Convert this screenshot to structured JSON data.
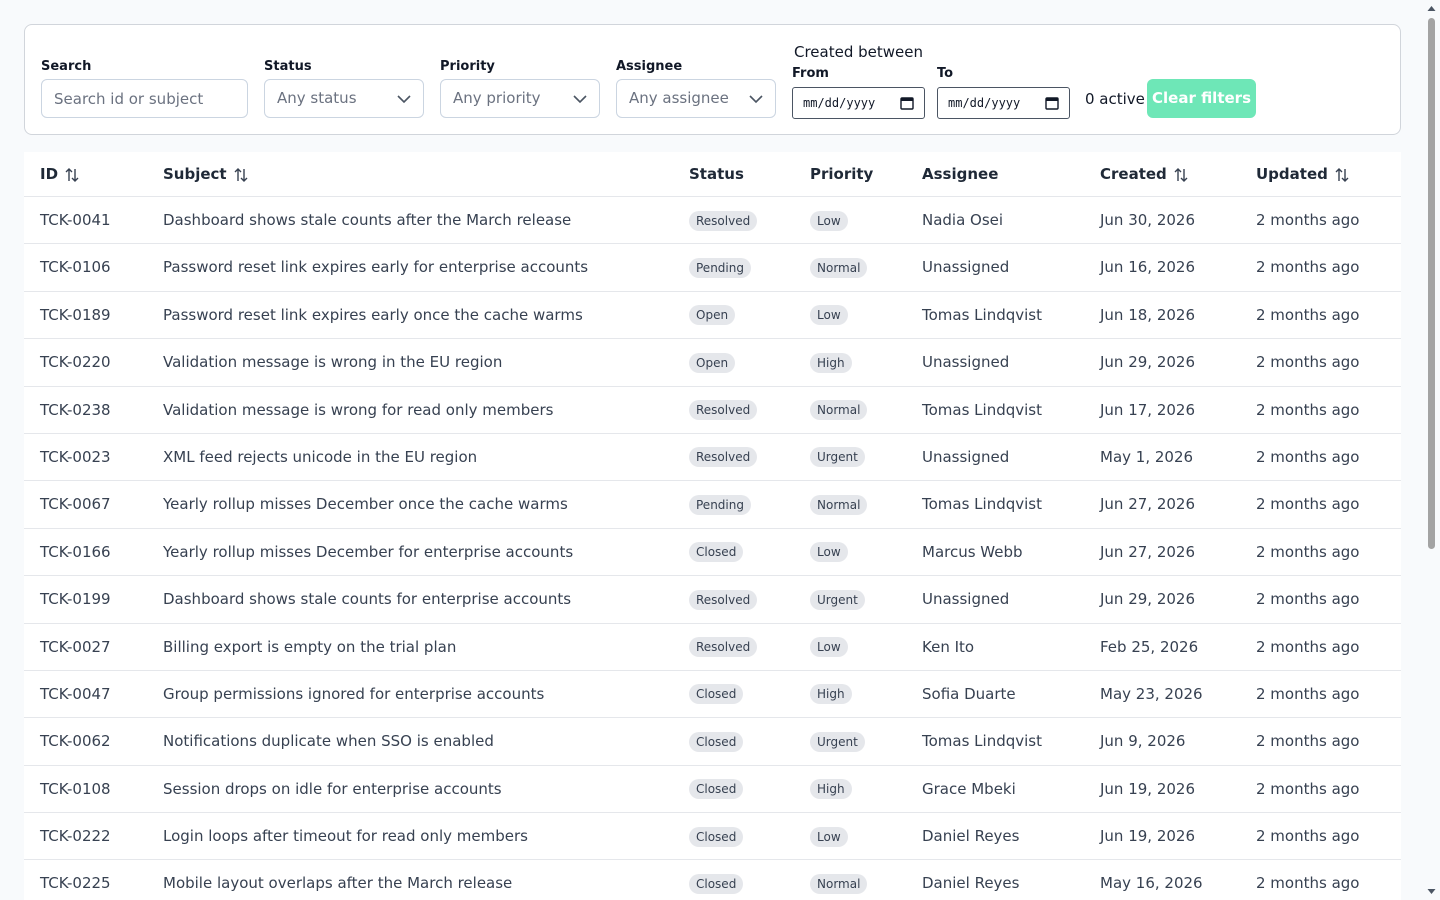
{
  "filters": {
    "search": {
      "label": "Search",
      "placeholder": "Search id or subject"
    },
    "status": {
      "label": "Status",
      "value": "Any status"
    },
    "priority": {
      "label": "Priority",
      "value": "Any priority"
    },
    "assignee": {
      "label": "Assignee",
      "value": "Any assignee"
    },
    "created_between": "Created between",
    "from": {
      "label": "From",
      "value": "mm/dd/yyyy"
    },
    "to": {
      "label": "To",
      "value": "mm/dd/yyyy"
    },
    "active_count": "0 active",
    "clear_label": "Clear filters"
  },
  "table": {
    "headers": {
      "id": "ID",
      "subject": "Subject",
      "status": "Status",
      "priority": "Priority",
      "assignee": "Assignee",
      "created": "Created",
      "updated": "Updated"
    },
    "rows": [
      {
        "id": "TCK-0041",
        "subject": "Dashboard shows stale counts after the March release",
        "status": "Resolved",
        "priority": "Low",
        "assignee": "Nadia Osei",
        "created": "Jun 30, 2026",
        "updated": "2 months ago"
      },
      {
        "id": "TCK-0106",
        "subject": "Password reset link expires early for enterprise accounts",
        "status": "Pending",
        "priority": "Normal",
        "assignee": "Unassigned",
        "created": "Jun 16, 2026",
        "updated": "2 months ago"
      },
      {
        "id": "TCK-0189",
        "subject": "Password reset link expires early once the cache warms",
        "status": "Open",
        "priority": "Low",
        "assignee": "Tomas Lindqvist",
        "created": "Jun 18, 2026",
        "updated": "2 months ago"
      },
      {
        "id": "TCK-0220",
        "subject": "Validation message is wrong in the EU region",
        "status": "Open",
        "priority": "High",
        "assignee": "Unassigned",
        "created": "Jun 29, 2026",
        "updated": "2 months ago"
      },
      {
        "id": "TCK-0238",
        "subject": "Validation message is wrong for read only members",
        "status": "Resolved",
        "priority": "Normal",
        "assignee": "Tomas Lindqvist",
        "created": "Jun 17, 2026",
        "updated": "2 months ago"
      },
      {
        "id": "TCK-0023",
        "subject": "XML feed rejects unicode in the EU region",
        "status": "Resolved",
        "priority": "Urgent",
        "assignee": "Unassigned",
        "created": "May 1, 2026",
        "updated": "2 months ago"
      },
      {
        "id": "TCK-0067",
        "subject": "Yearly rollup misses December once the cache warms",
        "status": "Pending",
        "priority": "Normal",
        "assignee": "Tomas Lindqvist",
        "created": "Jun 27, 2026",
        "updated": "2 months ago"
      },
      {
        "id": "TCK-0166",
        "subject": "Yearly rollup misses December for enterprise accounts",
        "status": "Closed",
        "priority": "Low",
        "assignee": "Marcus Webb",
        "created": "Jun 27, 2026",
        "updated": "2 months ago"
      },
      {
        "id": "TCK-0199",
        "subject": "Dashboard shows stale counts for enterprise accounts",
        "status": "Resolved",
        "priority": "Urgent",
        "assignee": "Unassigned",
        "created": "Jun 29, 2026",
        "updated": "2 months ago"
      },
      {
        "id": "TCK-0027",
        "subject": "Billing export is empty on the trial plan",
        "status": "Resolved",
        "priority": "Low",
        "assignee": "Ken Ito",
        "created": "Feb 25, 2026",
        "updated": "2 months ago"
      },
      {
        "id": "TCK-0047",
        "subject": "Group permissions ignored for enterprise accounts",
        "status": "Closed",
        "priority": "High",
        "assignee": "Sofia Duarte",
        "created": "May 23, 2026",
        "updated": "2 months ago"
      },
      {
        "id": "TCK-0062",
        "subject": "Notifications duplicate when SSO is enabled",
        "status": "Closed",
        "priority": "Urgent",
        "assignee": "Tomas Lindqvist",
        "created": "Jun 9, 2026",
        "updated": "2 months ago"
      },
      {
        "id": "TCK-0108",
        "subject": "Session drops on idle for enterprise accounts",
        "status": "Closed",
        "priority": "High",
        "assignee": "Grace Mbeki",
        "created": "Jun 19, 2026",
        "updated": "2 months ago"
      },
      {
        "id": "TCK-0222",
        "subject": "Login loops after timeout for read only members",
        "status": "Closed",
        "priority": "Low",
        "assignee": "Daniel Reyes",
        "created": "Jun 19, 2026",
        "updated": "2 months ago"
      },
      {
        "id": "TCK-0225",
        "subject": "Mobile layout overlaps after the March release",
        "status": "Closed",
        "priority": "Normal",
        "assignee": "Daniel Reyes",
        "created": "May 16, 2026",
        "updated": "2 months ago"
      }
    ]
  },
  "colors": {
    "accent": "#6ee7b7",
    "badge_bg": "#e5e7eb",
    "border": "#e5e7eb"
  },
  "icons": {
    "sort": "sort-arrows-icon",
    "chevron": "chevron-down-icon",
    "calendar": "calendar-icon"
  }
}
